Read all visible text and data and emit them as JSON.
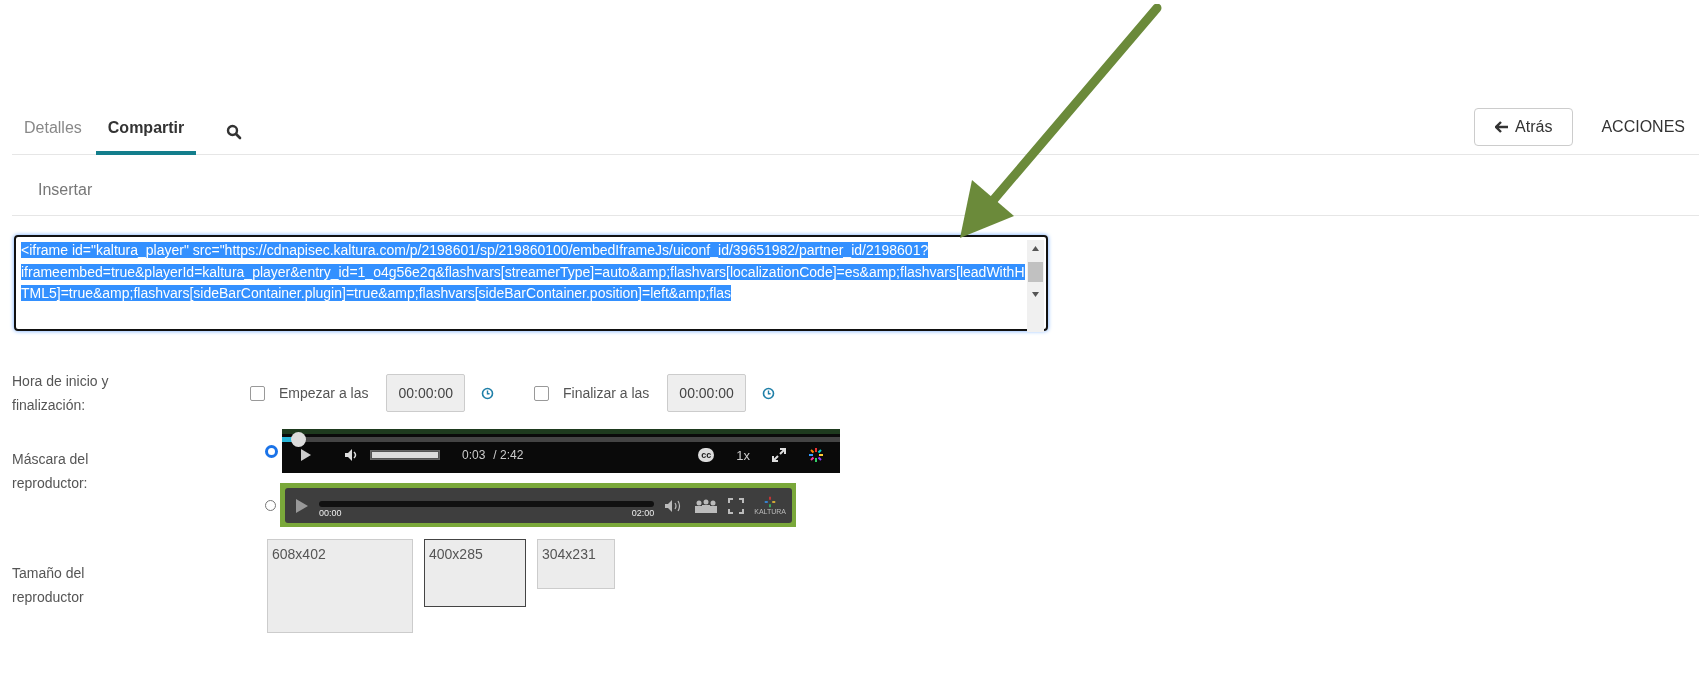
{
  "tabs": [
    {
      "label": "Detalles",
      "selected": false
    },
    {
      "label": "Compartir",
      "selected": true
    }
  ],
  "back_button": {
    "label": "Atrás"
  },
  "actions_menu": {
    "label": "ACCIONES"
  },
  "section_title": "Insertar",
  "embed_code": {
    "value": "<iframe id=\"kaltura_player\" src=\"https://cdnapisec.kaltura.com/p/2198601/sp/219860100/embedIframeJs/uiconf_id/39651982/partner_id/2198601?iframeembed=true&playerId=kaltura_player&entry_id=1_o4g56e2q&flashvars[streamerType]=auto&amp;flashvars[localizationCode]=es&amp;flashvars[leadWithHTML5]=true&amp;flashvars[sideBarContainer.plugin]=true&amp;flashvars[sideBarContainer.position]=left&amp;flas",
    "selected": true
  },
  "time_range": {
    "label": "Hora de inicio y finalización:",
    "start": {
      "label": "Empezar a las",
      "checked": false,
      "value": "00:00:00",
      "disabled": true
    },
    "end": {
      "label": "Finalizar a las",
      "checked": false,
      "value": "00:00:00",
      "disabled": true
    }
  },
  "player_skin": {
    "label": "Máscara del reproductor:",
    "options": [
      {
        "kind": "modern",
        "selected": true,
        "level": 0.03,
        "time": "0:03",
        "duration": "/ 2:42",
        "captions": "cc",
        "speed": "1x",
        "volume": {
          "level": 1
        }
      },
      {
        "kind": "classic",
        "selected": false,
        "time": "00:00",
        "duration": "02:00",
        "brand": "KALTURA"
      }
    ]
  },
  "player_size": {
    "label": "Tamaño del reproductor",
    "options": [
      {
        "label": "608x402",
        "selected": false
      },
      {
        "label": "400x285",
        "selected": true
      },
      {
        "label": "304x231",
        "selected": false
      }
    ]
  }
}
